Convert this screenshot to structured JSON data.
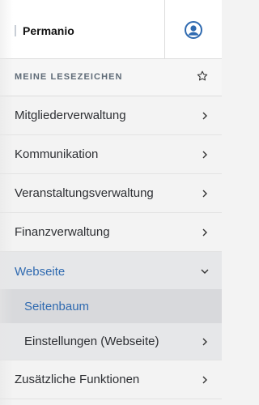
{
  "header": {
    "logo_text": "Permanio",
    "user_icon": "user-circle-icon",
    "accent": "#2f6ab0"
  },
  "bookmarks": {
    "label": "MEINE LESEZEICHEN",
    "icon": "star-outline-icon"
  },
  "nav": {
    "items": [
      {
        "label": "Mitgliederverwaltung"
      },
      {
        "label": "Kommunikation"
      },
      {
        "label": "Veranstaltungsverwaltung"
      },
      {
        "label": "Finanzverwaltung"
      },
      {
        "label": "Webseite",
        "expanded": true
      },
      {
        "label": "Zusätzliche Funktionen"
      }
    ],
    "subitems": [
      {
        "label": "Seitenbaum",
        "selected": true
      },
      {
        "label": "Einstellungen (Webseite)"
      }
    ]
  }
}
